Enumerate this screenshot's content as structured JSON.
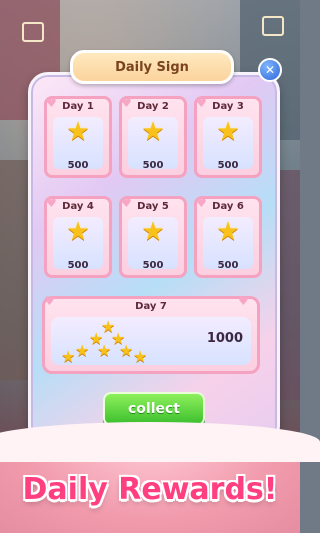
{
  "dialog": {
    "title": "Daily Sign",
    "close_symbol": "✕",
    "days": [
      {
        "label": "Day 1",
        "amount": "500",
        "icon": "star-icon"
      },
      {
        "label": "Day 2",
        "amount": "500",
        "icon": "star-icon"
      },
      {
        "label": "Day 3",
        "amount": "500",
        "icon": "star-icon"
      },
      {
        "label": "Day 4",
        "amount": "500",
        "icon": "star-icon"
      },
      {
        "label": "Day 5",
        "amount": "500",
        "icon": "star-icon"
      },
      {
        "label": "Day 6",
        "amount": "500",
        "icon": "star-icon"
      }
    ],
    "day7": {
      "label": "Day 7",
      "amount": "1000",
      "icon": "star-pile-icon"
    },
    "collect_label": "collect"
  },
  "banner": {
    "text": "Daily Rewards!"
  },
  "colors": {
    "collect_button": "#3cbf2e",
    "card_border": "#f4a2c0",
    "star": "#f8c21b",
    "banner_text": "#ff3f7f",
    "close_button": "#2f67d8"
  }
}
